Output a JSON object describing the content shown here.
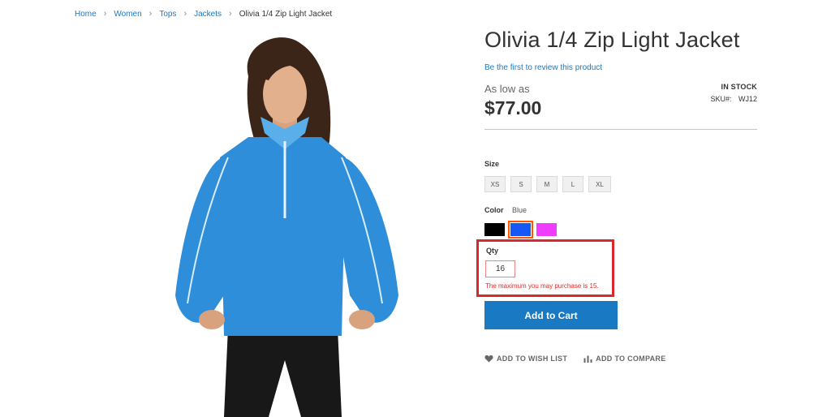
{
  "breadcrumbs": {
    "items": [
      "Home",
      "Women",
      "Tops",
      "Jackets"
    ],
    "current": "Olivia 1/4 Zip Light Jacket",
    "separator": "›"
  },
  "product": {
    "title": "Olivia 1/4 Zip Light Jacket",
    "review_link": "Be the first to review this product",
    "price_prefix": "As low as",
    "price": "$77.00",
    "stock": "IN STOCK",
    "sku_label": "SKU#:",
    "sku_value": "WJ12"
  },
  "options": {
    "size_label": "Size",
    "sizes": [
      "XS",
      "S",
      "M",
      "L",
      "XL"
    ],
    "color_label": "Color",
    "color_selected": "Blue",
    "colors": [
      {
        "name": "Black",
        "hex": "#000000"
      },
      {
        "name": "Blue",
        "hex": "#1857f7"
      },
      {
        "name": "Purple",
        "hex": "#ef3dff"
      }
    ]
  },
  "qty": {
    "label": "Qty",
    "value": "16",
    "error": "The maximum you may purchase is 15."
  },
  "cart": {
    "add_label": "Add to Cart"
  },
  "actions": {
    "wishlist": "ADD TO WISH LIST",
    "compare": "ADD TO COMPARE"
  },
  "colors": {
    "accent": "#1979c3",
    "error": "#e02b27",
    "highlight_border": "#d8282d",
    "jacket": "#2f8ed9"
  }
}
